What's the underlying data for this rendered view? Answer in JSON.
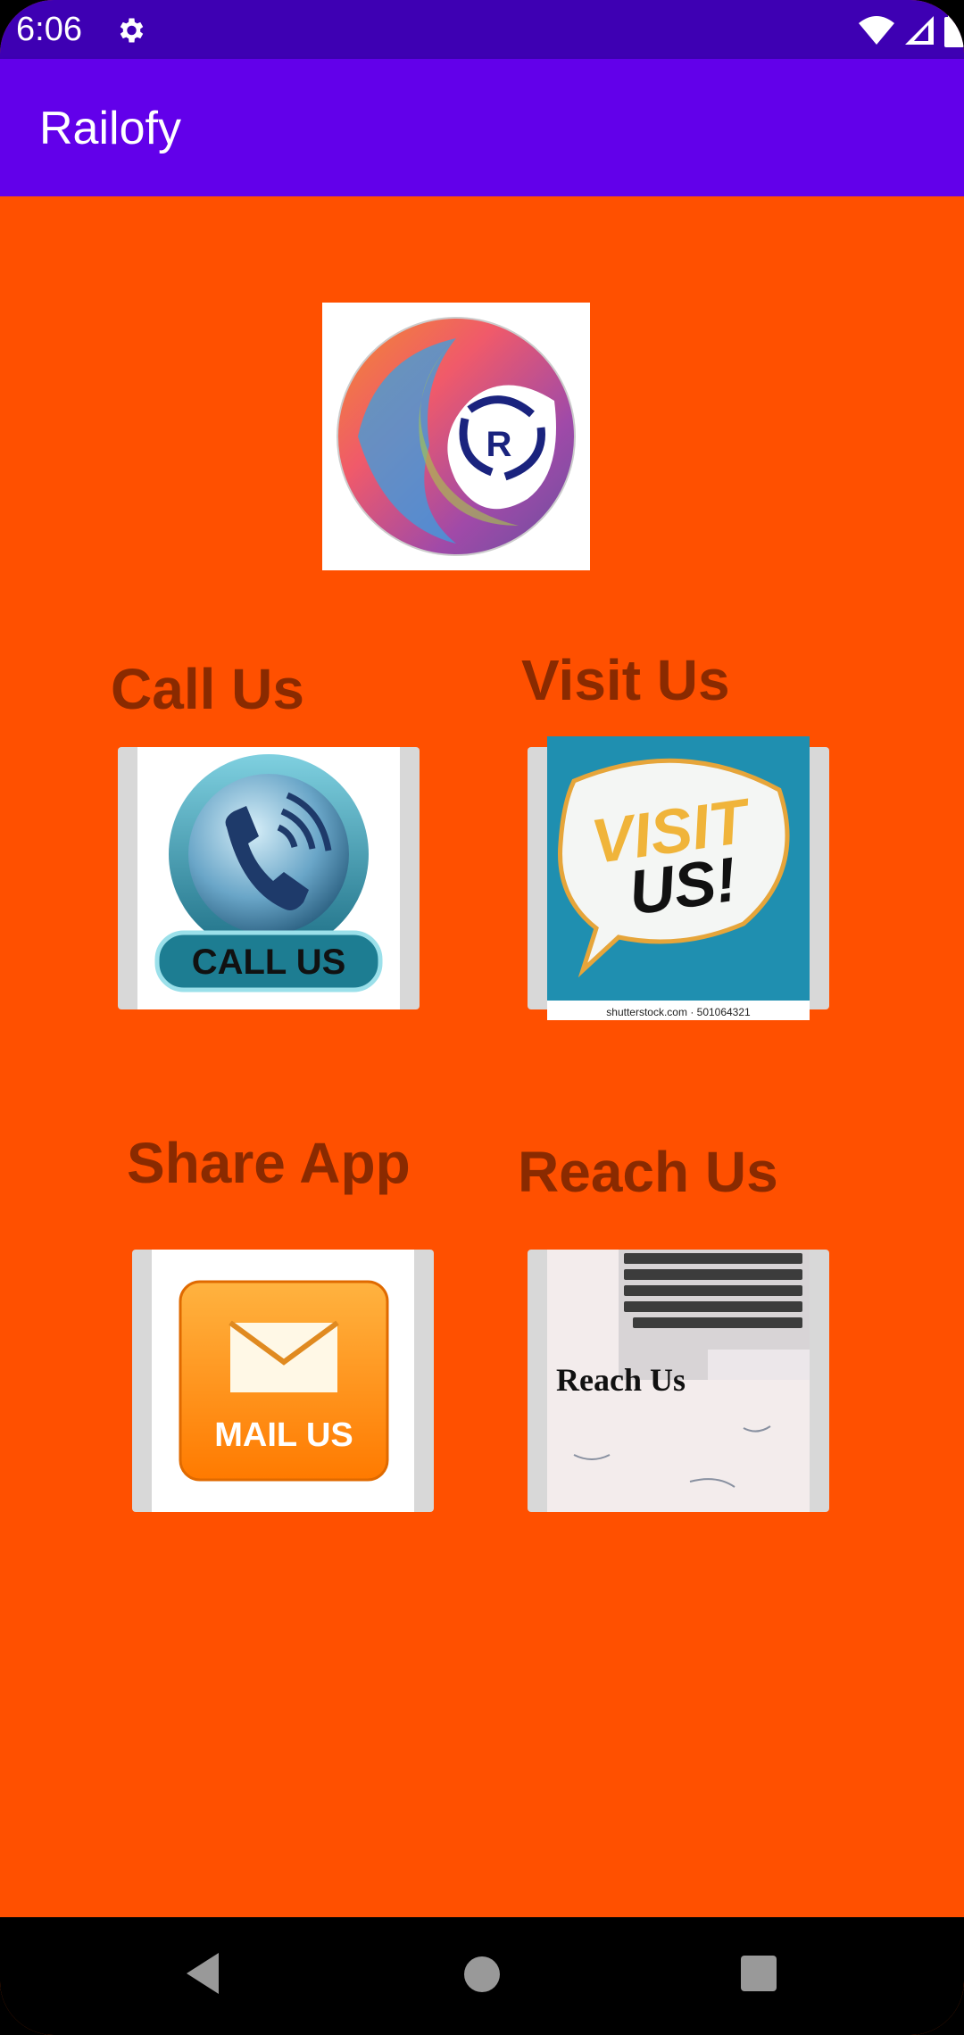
{
  "status": {
    "time": "6:06"
  },
  "appbar": {
    "title": "Railofy"
  },
  "logo": {
    "label": "R"
  },
  "grid": {
    "call": {
      "label": "Call Us",
      "image_text": "CALL US"
    },
    "visit": {
      "label": "Visit Us",
      "image_text_1": "VISIT",
      "image_text_2": "US!",
      "caption": "shutterstock.com · 501064321"
    },
    "share": {
      "label": "Share App",
      "image_text": "MAIL US"
    },
    "reach": {
      "label": "Reach Us",
      "image_text": "Reach Us"
    }
  },
  "colors": {
    "status_bar": "#3e00b3",
    "app_bar": "#6200ea",
    "background": "#ff5000",
    "label": "#8a2a00"
  }
}
